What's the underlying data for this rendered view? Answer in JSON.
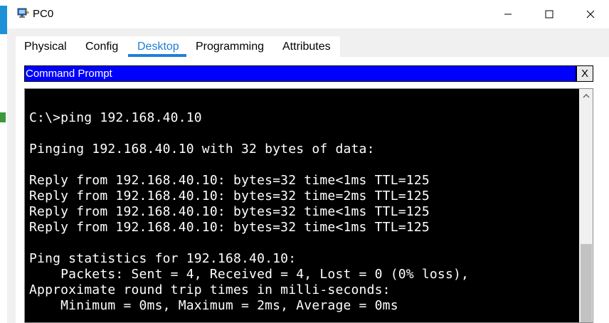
{
  "window": {
    "title": "PC0",
    "icon": "pc-icon",
    "controls": [
      "minimize-icon",
      "maximize-icon",
      "close-icon"
    ]
  },
  "tabs": {
    "items": [
      {
        "label": "Physical"
      },
      {
        "label": "Config"
      },
      {
        "label": "Desktop"
      },
      {
        "label": "Programming"
      },
      {
        "label": "Attributes"
      }
    ],
    "active": "Desktop"
  },
  "command_prompt": {
    "title": "Command Prompt",
    "close_label": "X",
    "lines": [
      "",
      "C:\\>ping 192.168.40.10",
      "",
      "Pinging 192.168.40.10 with 32 bytes of data:",
      "",
      "Reply from 192.168.40.10: bytes=32 time<1ms TTL=125",
      "Reply from 192.168.40.10: bytes=32 time=2ms TTL=125",
      "Reply from 192.168.40.10: bytes=32 time<1ms TTL=125",
      "Reply from 192.168.40.10: bytes=32 time<1ms TTL=125",
      "",
      "Ping statistics for 192.168.40.10:",
      "    Packets: Sent = 4, Received = 4, Lost = 0 (0% loss),",
      "Approximate round trip times in milli-seconds:",
      "    Minimum = 0ms, Maximum = 2ms, Average = 0ms"
    ]
  },
  "colors": {
    "tab_active": "#1e7fd8",
    "header_bar": "#0000ff",
    "terminal_bg": "#000000",
    "terminal_fg": "#ffffff"
  }
}
